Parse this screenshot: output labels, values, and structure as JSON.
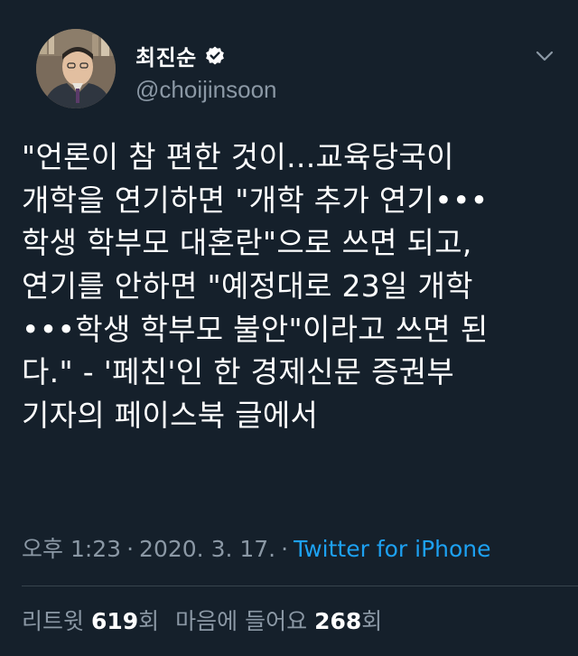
{
  "author": {
    "display_name": "최진순",
    "handle": "@choijinsoon",
    "verified": true
  },
  "tweet": {
    "lines": [
      "\"언론이 참 편한 것이...교육당국이",
      "개학을 연기하면 \"개학 추가 연기•••",
      "학생 학부모 대혼란\"으로 쓰면 되고,",
      "연기를 안하면 \"예정대로 23일 개학",
      "•••학생 학부모 불안\"이라고 쓰면 된",
      "다.\" - '페친'인 한 경제신문 증권부",
      "기자의 페이스북 글에서"
    ]
  },
  "meta": {
    "time": "오후 1:23",
    "separator": "·",
    "date": "2020. 3. 17.",
    "source": "Twitter for iPhone"
  },
  "stats": {
    "retweets_label": "리트윗",
    "retweets_count": "619",
    "retweets_unit": "회",
    "likes_label": "마음에 들어요",
    "likes_count": "268",
    "likes_unit": "회"
  },
  "icons": {
    "verified": "verified-badge-icon",
    "menu": "chevron-down-icon"
  },
  "colors": {
    "background": "#15202b",
    "text": "#ffffff",
    "secondary": "#8b98a5",
    "link": "#1da1f2",
    "divider": "#38444d"
  }
}
